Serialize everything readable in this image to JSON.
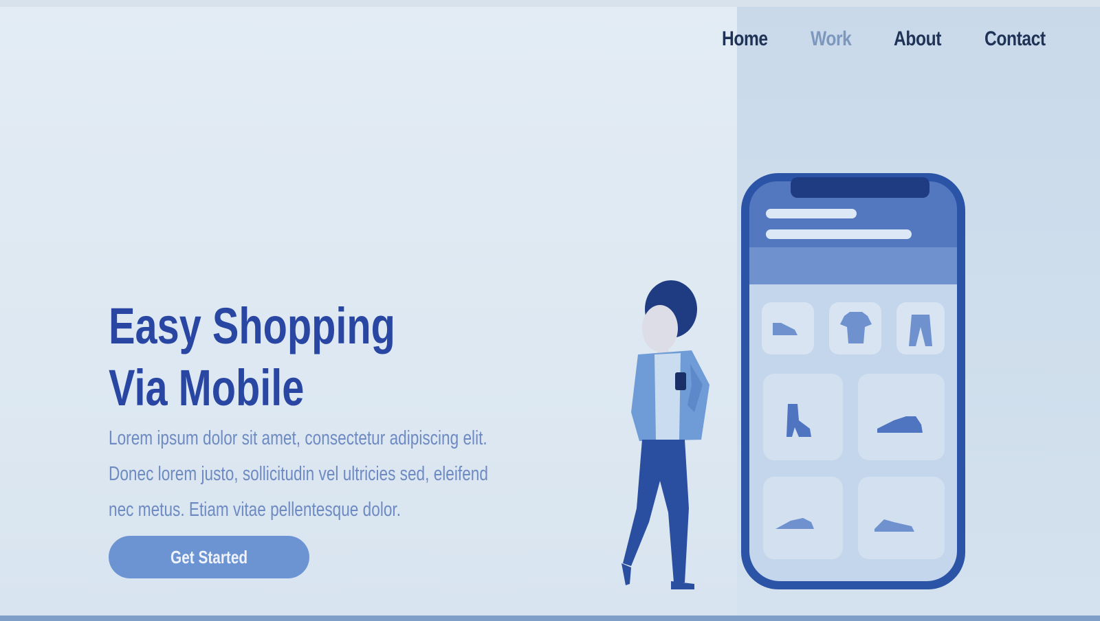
{
  "nav": {
    "items": [
      {
        "label": "Home",
        "active": false
      },
      {
        "label": "Work",
        "active": true
      },
      {
        "label": "About",
        "active": false
      },
      {
        "label": "Contact",
        "active": false
      }
    ]
  },
  "hero": {
    "title_line1": "Easy Shopping",
    "title_line2": "Via Mobile",
    "description": "Lorem ipsum dolor sit amet, consectetur  adipiscing elit. Donec lorem justo, sollicitudin vel ultricies sed, eleifend nec metus. Etiam vitae pellentesque dolor.",
    "cta_label": "Get Started"
  },
  "illustration": {
    "phone_tiles_top": [
      "shoe-icon",
      "tshirt-icon",
      "pants-icon"
    ],
    "phone_tiles_grid": [
      "boot-icon",
      "sneaker-icon",
      "shoe-icon",
      "sneaker-icon"
    ]
  },
  "colors": {
    "title": "#2947a2",
    "nav_text": "#1f3357",
    "nav_active": "#7d97bd",
    "cta_bg": "#6d94d2",
    "phone_frame": "#2b54a6",
    "text_muted": "#6e8ac2"
  }
}
